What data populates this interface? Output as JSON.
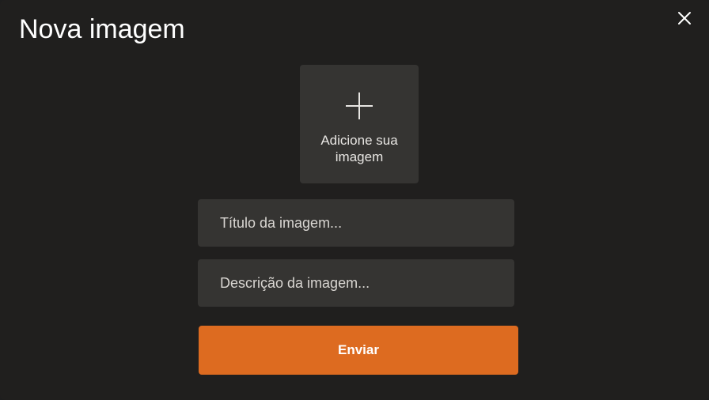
{
  "modal": {
    "title": "Nova imagem",
    "close_icon": "close-icon"
  },
  "upload": {
    "icon": "plus-icon",
    "label": "Adicione sua imagem"
  },
  "form": {
    "title_placeholder": "Título da imagem...",
    "title_value": "",
    "description_placeholder": "Descrição da imagem...",
    "description_value": "",
    "submit_label": "Enviar"
  },
  "colors": {
    "background": "#201f1e",
    "field_background": "#353432",
    "accent": "#dd6b20",
    "text": "#ffffff"
  }
}
